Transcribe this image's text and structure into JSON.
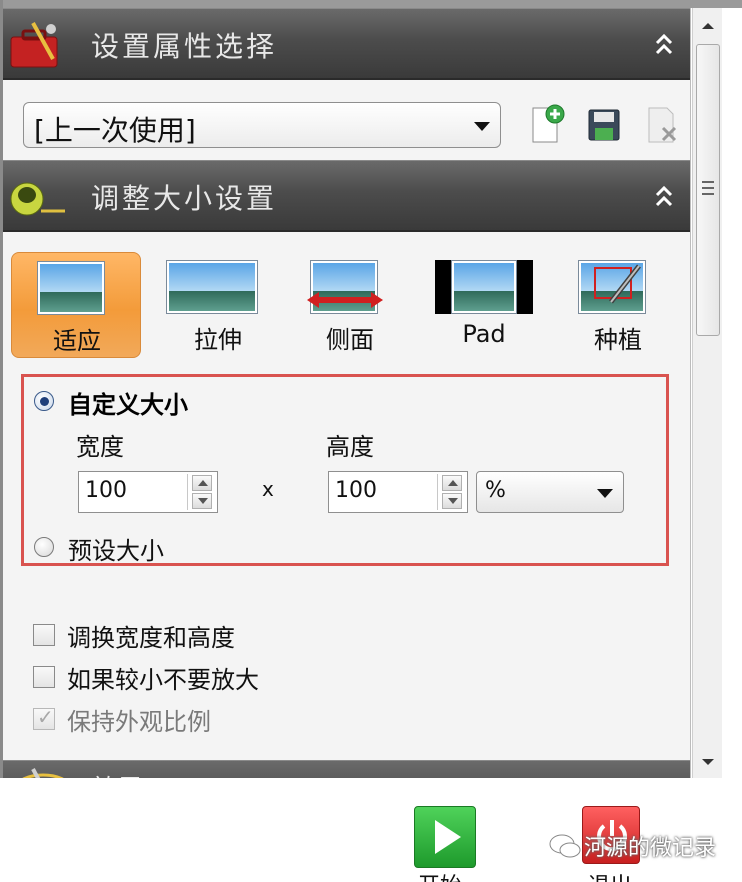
{
  "settings_header": {
    "title": "设置属性选择"
  },
  "preset": {
    "selected": "[上一次使用]"
  },
  "resize_header": {
    "title": "调整大小设置"
  },
  "modes": [
    {
      "label": "适应",
      "active": true
    },
    {
      "label": "拉伸",
      "active": false
    },
    {
      "label": "侧面",
      "active": false
    },
    {
      "label": "Pad",
      "active": false
    },
    {
      "label": "种植",
      "active": false
    }
  ],
  "size": {
    "custom_label": "自定义大小",
    "width_label": "宽度",
    "height_label": "高度",
    "width_value": "100",
    "height_value": "100",
    "separator": "x",
    "unit": "%",
    "preset_label": "预设大小"
  },
  "options": [
    {
      "label": "调换宽度和高度",
      "checked": false,
      "disabled": false
    },
    {
      "label": "如果较小不要放大",
      "checked": false,
      "disabled": false
    },
    {
      "label": "保持外观比例",
      "checked": true,
      "disabled": true
    }
  ],
  "effects_header": {
    "title": "效果"
  },
  "bottom": {
    "start_label": "开始",
    "stop_label": "退出"
  },
  "watermark": "河源的微记录",
  "colors": {
    "active_mode": "#f39b3a",
    "highlight_border": "#d9534f",
    "header_bg": "#4c4c4c"
  }
}
